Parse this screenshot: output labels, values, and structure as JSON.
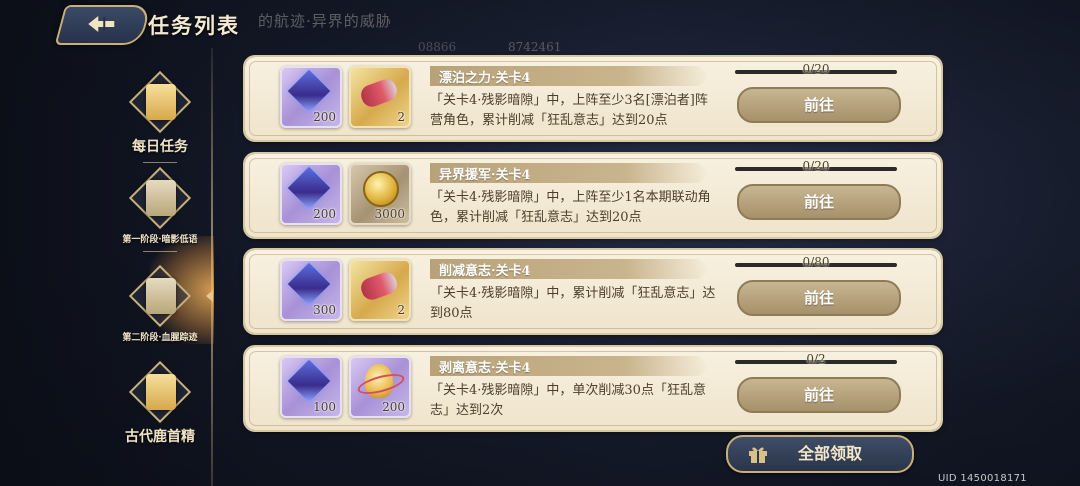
{
  "header": {
    "title": "任务列表"
  },
  "background": {
    "event_title": "的航迹·异界的威胁",
    "num1": "08866",
    "num2": "8742461"
  },
  "sidebar": {
    "items": [
      {
        "label": "每日任务",
        "state": "normal"
      },
      {
        "label": "第一阶段·暗影低语",
        "state": "normal"
      },
      {
        "label": "第二阶段·血腥踪迹",
        "state": "selected"
      },
      {
        "label": "古代鹿首精",
        "state": "normal"
      }
    ]
  },
  "tasks": [
    {
      "title": "漂泊之力·关卡4",
      "description": "「关卡4·残影暗隙」中，上阵至少3名[漂泊者]阵营角色，累计削减「狂乱意志」达到20点",
      "progress_text": "0/20",
      "progress": 0,
      "button": "前往",
      "rewards": [
        {
          "icon": "crystal-icon",
          "count": "200"
        },
        {
          "icon": "scroll-icon",
          "count": "2"
        }
      ]
    },
    {
      "title": "异界援军·关卡4",
      "description": "「关卡4·残影暗隙」中，上阵至少1名本期联动角色，累计削减「狂乱意志」达到20点",
      "progress_text": "0/20",
      "progress": 0,
      "button": "前往",
      "rewards": [
        {
          "icon": "crystal-icon",
          "count": "200"
        },
        {
          "icon": "coin-icon",
          "count": "3000"
        }
      ]
    },
    {
      "title": "削减意志·关卡4",
      "description": "「关卡4·残影暗隙」中，累计削减「狂乱意志」达到80点",
      "progress_text": "0/80",
      "progress": 0,
      "button": "前往",
      "rewards": [
        {
          "icon": "crystal-icon",
          "count": "300"
        },
        {
          "icon": "scroll-icon",
          "count": "2"
        }
      ]
    },
    {
      "title": "剥离意志·关卡4",
      "description": "「关卡4·残影暗隙」中，单次削减30点「狂乱意志」达到2次",
      "progress_text": "0/2",
      "progress": 0,
      "button": "前往",
      "rewards": [
        {
          "icon": "crystal-icon",
          "count": "100"
        },
        {
          "icon": "flask-icon",
          "count": "200"
        }
      ]
    }
  ],
  "footer": {
    "claim_all": "全部领取",
    "uid": "UID 1450018171"
  },
  "colors": {
    "accent_gold": "#c9b07a",
    "card_bg": "#f8f1e1",
    "button_brown": "#a5916a"
  }
}
